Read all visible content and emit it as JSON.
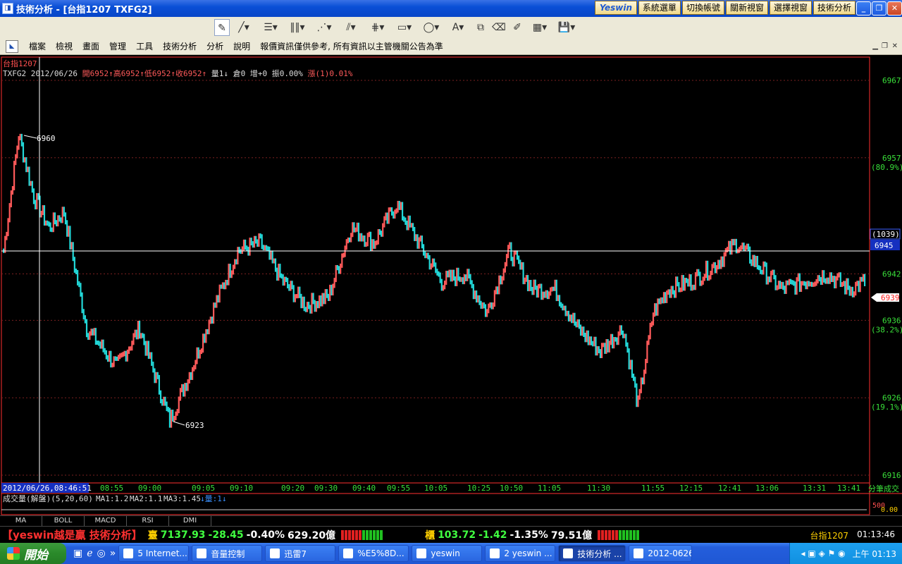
{
  "window": {
    "title": "技術分析 - [台指1207 TXFG2]",
    "buttons": [
      "Yeswin",
      "系統選單",
      "切換帳號",
      "關新視窗",
      "選擇視窗",
      "技術分析"
    ]
  },
  "menu": {
    "items": [
      "檔案",
      "檢視",
      "畫面",
      "管理",
      "工具",
      "技術分析",
      "分析",
      "說明"
    ],
    "notice": "報價資訊僅供參考, 所有資訊以主管機關公告為準"
  },
  "chart": {
    "symbol_name": "台指1207",
    "symbol_code": "TXFG2",
    "date": "2012/06/26",
    "open": "開6952↑",
    "high": "高6952↑",
    "low": "低6952↑",
    "close": "收6952↑",
    "volume": "量1↓",
    "oi": "倉0",
    "oi_change": "增+0",
    "amplitude": "振0.00%",
    "change": "漲(1)0.01%",
    "high_marker": "6960",
    "low_marker": "6923",
    "cursor_time": "2012/06/26,08:46:51",
    "cursor_price": "6945",
    "cursor_value": "(1039)",
    "last_price": "6939",
    "vol_label": "成交量(解盤)(5,20,60)",
    "ma1": "MA1:1.2",
    "ma2": "MA2:1.1",
    "ma3": "MA3:1.45",
    "vol_now": "↓量:1↓",
    "vol_axis_label": "分筆成交",
    "vol_scale": "500",
    "vol_zero": "0.00",
    "colors": {
      "up": "#ff5a5a",
      "down": "#22d8d8",
      "axis": "#ff3030",
      "grid": "#7a2020",
      "text_green": "#3ae03a"
    }
  },
  "chart_data": {
    "type": "line",
    "y_ticks": [
      {
        "value": "6967",
        "pct": ""
      },
      {
        "value": "6957",
        "pct": "(80.9%)"
      },
      {
        "value": "6942",
        "pct": ""
      },
      {
        "value": "6936",
        "pct": "(38.2%)"
      },
      {
        "value": "6926",
        "pct": "(19.1%)"
      },
      {
        "value": "6916",
        "pct": ""
      }
    ],
    "x_ticks": [
      "08:55",
      "09:00",
      "09:05",
      "09:10",
      "09:20",
      "09:30",
      "09:40",
      "09:55",
      "10:05",
      "10:25",
      "10:50",
      "11:05",
      "11:30",
      "11:55",
      "12:15",
      "12:41",
      "13:06",
      "13:31",
      "13:41"
    ],
    "ylim": [
      6916,
      6967
    ],
    "anchors": [
      [
        0,
        6945
      ],
      [
        10,
        6960
      ],
      [
        20,
        6952
      ],
      [
        30,
        6948
      ],
      [
        40,
        6950
      ],
      [
        55,
        6935
      ],
      [
        75,
        6930
      ],
      [
        90,
        6935
      ],
      [
        110,
        6923
      ],
      [
        125,
        6930
      ],
      [
        140,
        6938
      ],
      [
        155,
        6945
      ],
      [
        170,
        6946
      ],
      [
        185,
        6941
      ],
      [
        200,
        6938
      ],
      [
        215,
        6939
      ],
      [
        230,
        6948
      ],
      [
        245,
        6946
      ],
      [
        260,
        6951
      ],
      [
        275,
        6946
      ],
      [
        290,
        6941
      ],
      [
        305,
        6942
      ],
      [
        320,
        6937
      ],
      [
        335,
        6945
      ],
      [
        350,
        6940
      ],
      [
        365,
        6940
      ],
      [
        380,
        6935
      ],
      [
        395,
        6932
      ],
      [
        410,
        6935
      ],
      [
        420,
        6925
      ],
      [
        430,
        6937
      ],
      [
        440,
        6940
      ],
      [
        455,
        6941
      ],
      [
        470,
        6943
      ],
      [
        485,
        6946
      ],
      [
        500,
        6943
      ],
      [
        515,
        6940
      ],
      [
        530,
        6941
      ],
      [
        545,
        6942
      ],
      [
        560,
        6940
      ],
      [
        570,
        6941
      ]
    ]
  },
  "tabs": [
    "MA",
    "BOLL",
    "MACD",
    "RSI",
    "DMI"
  ],
  "status": {
    "slogan": "【yeswin越是贏 技術分析】",
    "quote1": {
      "label": "臺",
      "value": "7137.93",
      "change": "-28.45",
      "pct": "-0.40%",
      "amount": "629.20億"
    },
    "quote2": {
      "label": "櫃",
      "value": "103.72",
      "change": "-1.42",
      "pct": "-1.35%",
      "amount": "79.51億"
    },
    "right_label": "台指1207",
    "right_time": "01:13:46"
  },
  "taskbar": {
    "start": "開始",
    "tasks": [
      "5 Internet...",
      "音量控制",
      "迅雷7",
      "%E5%8D...",
      "yeswin",
      "2 yeswin ...",
      "技術分析 ...",
      "2012-0626..."
    ],
    "clock": "上午 01:13"
  }
}
